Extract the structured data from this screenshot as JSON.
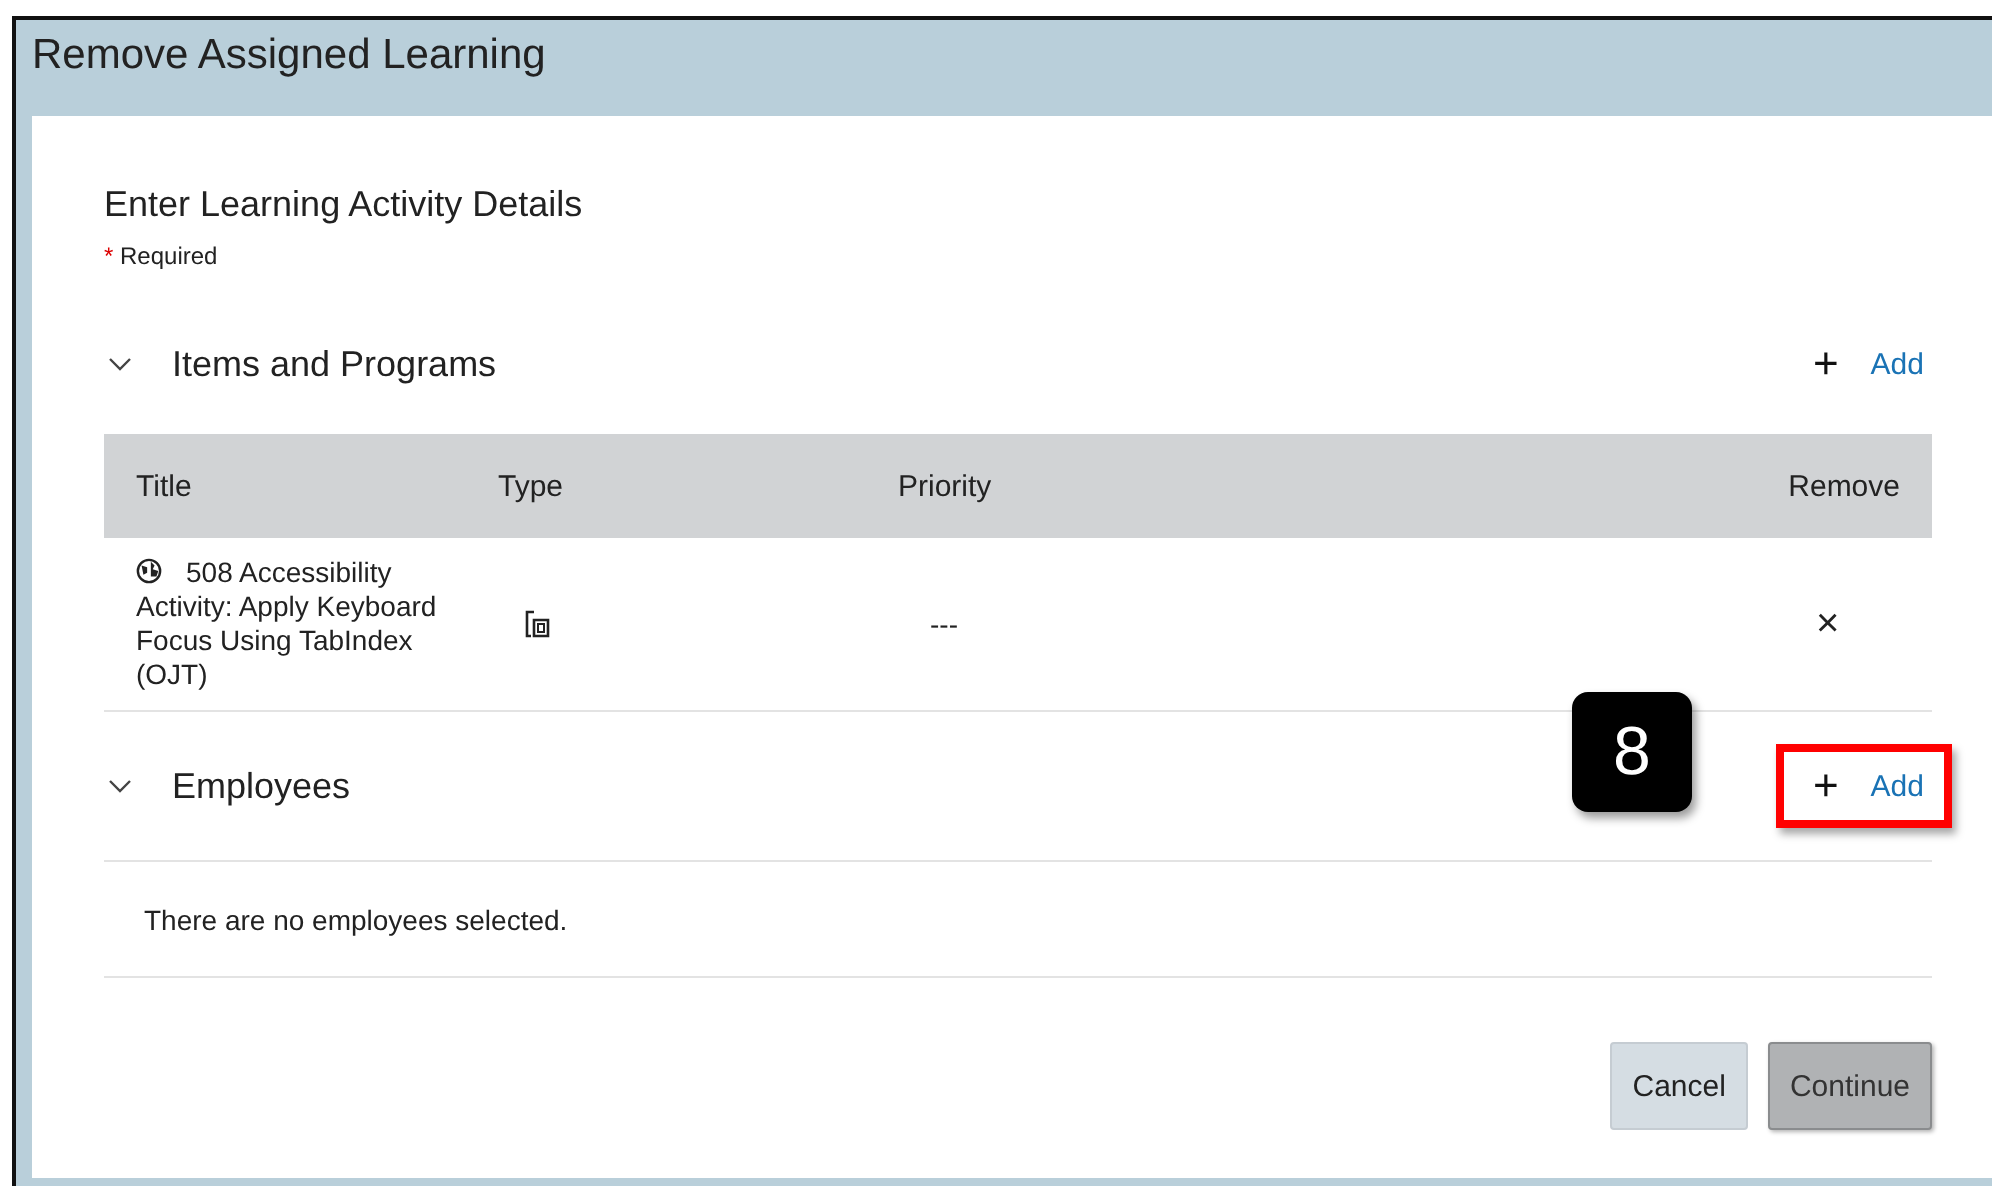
{
  "window": {
    "title": "Remove Assigned Learning"
  },
  "form": {
    "heading": "Enter Learning Activity Details",
    "required_mark": "*",
    "required_label": "Required"
  },
  "items_section": {
    "title": "Items and Programs",
    "expanded": true,
    "add_icon": "+",
    "add_label": "Add",
    "add_highlighted": false,
    "table": {
      "columns": [
        "Title",
        "Type",
        "Priority",
        "Remove"
      ],
      "rows": [
        {
          "title": "508 Accessibility Activity: Apply Keyboard Focus Using TabIndex (OJT)",
          "priority": "---",
          "remove": "×"
        }
      ]
    }
  },
  "employees_section": {
    "title": "Employees",
    "expanded": true,
    "add_icon": "+",
    "add_label": "Add",
    "add_highlighted": true,
    "empty_message": "There are no employees selected."
  },
  "callout": {
    "number": "8"
  },
  "buttons": [
    {
      "label": "Cancel",
      "kind": "secondary",
      "disabled": false
    },
    {
      "label": "Continue",
      "kind": "primary",
      "disabled": true
    }
  ]
}
